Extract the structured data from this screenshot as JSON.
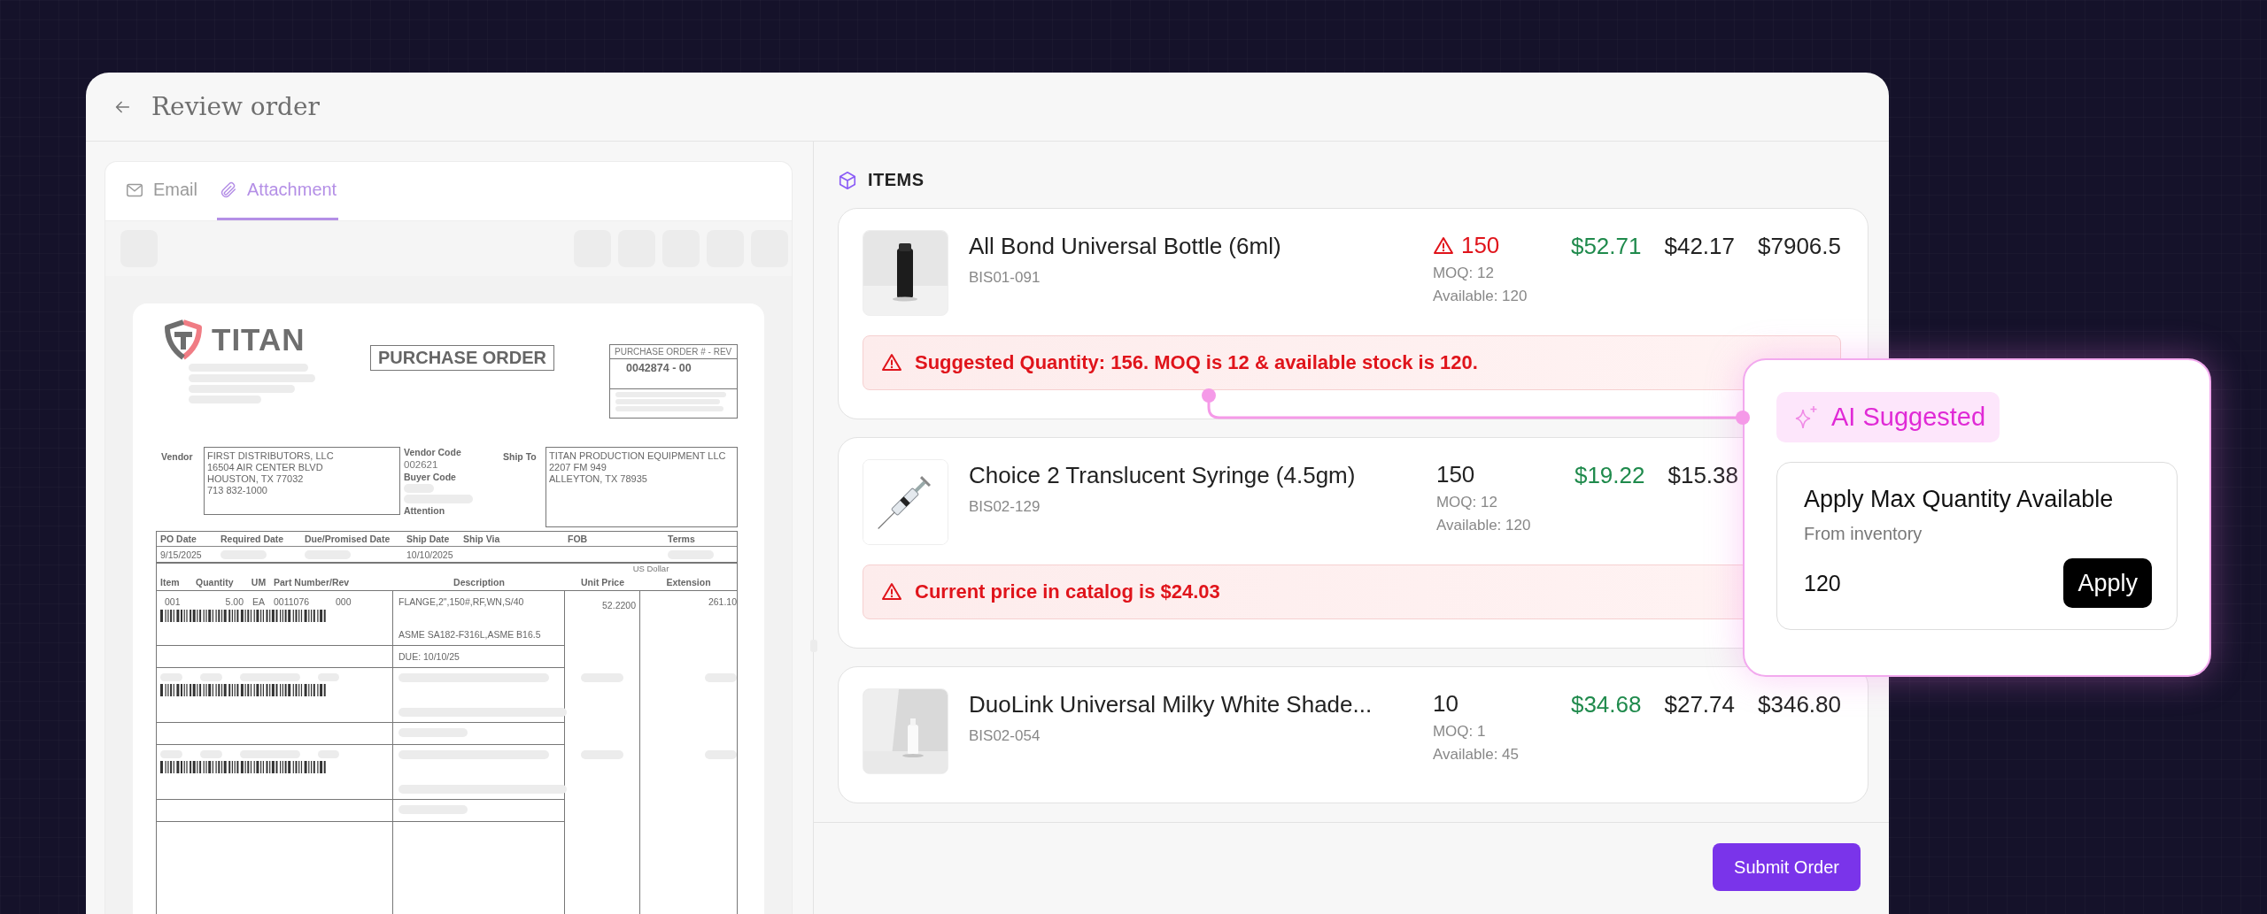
{
  "window": {
    "title": "Review order"
  },
  "tabs": [
    {
      "label": "Email",
      "selected": false
    },
    {
      "label": "Attachment",
      "selected": true
    }
  ],
  "document": {
    "company": "TITAN",
    "title": "PURCHASE ORDER",
    "po_label": "PURCHASE ORDER # - REV",
    "po_number": "0042874 - 00",
    "vendor_label": "Vendor",
    "vendor_lines": [
      "FIRST DISTRIBUTORS, LLC",
      "16504 AIR CENTER BLVD",
      "HOUSTON, TX 77032",
      "713 832-1000"
    ],
    "vendor_code_label": "Vendor Code",
    "vendor_code": "002621",
    "buyer_code_label": "Buyer Code",
    "attention_label": "Attention",
    "ship_to_label": "Ship To",
    "ship_to_lines": [
      "TITAN PRODUCTION EQUIPMENT LLC",
      "2207 FM 949",
      "ALLEYTON, TX 78935"
    ],
    "date_columns": [
      {
        "label": "PO Date",
        "value": "9/15/2025",
        "redacted": false
      },
      {
        "label": "Required Date",
        "redacted": true
      },
      {
        "label": "Due/Promised Date",
        "redacted": true
      },
      {
        "label": "Ship Date",
        "value": "10/10/2025",
        "redacted": false
      },
      {
        "label": "Ship Via",
        "redacted": false
      },
      {
        "label": "FOB",
        "redacted": false
      },
      {
        "label": "Terms",
        "redacted": true
      }
    ],
    "currency": "US Dollar",
    "line_columns": [
      "Item",
      "Quantity",
      "UM",
      "Part Number/Rev",
      "Description",
      "Unit Price",
      "Extension"
    ],
    "lines": [
      {
        "kind": "item",
        "item": "001",
        "quantity": "5.00",
        "um": "EA",
        "part": "0011076",
        "rev": "000",
        "description": "FLANGE,2\",150#,RF,WN,S/40",
        "description_2": "ASME SA182-F316L,ASME B16.5",
        "due": "DUE: 10/10/25",
        "unit_price": "52.2200",
        "extension": "261.10"
      },
      {
        "kind": "redacted"
      },
      {
        "kind": "redacted"
      }
    ]
  },
  "items_title": "ITEMS",
  "items": [
    {
      "name": "All Bond Universal Bottle (6ml)",
      "sku": "BIS01-091",
      "quantity": "150",
      "quantity_warning": true,
      "moq": "MOQ: 12",
      "available": "Available: 120",
      "price": "$52.71",
      "cost": "$42.17",
      "total": "$7906.5",
      "alert": "Suggested Quantity: **156**. MOQ is 12 & available stock is **120**."
    },
    {
      "name": "Choice 2 Translucent Syringe (4.5gm)",
      "sku": "BIS02-129",
      "quantity": "150",
      "quantity_warning": false,
      "moq": "MOQ: 12",
      "available": "Available: 120",
      "price": "$19.22",
      "cost": "$15.38",
      "alert": "Current price in catalog is **$24.03**"
    },
    {
      "name": "DuoLink Universal Milky White Shade...",
      "sku": "BIS02-054",
      "quantity": "10",
      "quantity_warning": false,
      "moq": "MOQ: 1",
      "available": "Available: 45",
      "price": "$34.68",
      "cost": "$27.74",
      "total": "$346.80"
    }
  ],
  "submit": "Submit Order",
  "suggestion": {
    "badge": "AI Suggested",
    "title": "Apply Max Quantity Available",
    "subtitle": "From inventory",
    "value": "120",
    "action": "Apply"
  }
}
